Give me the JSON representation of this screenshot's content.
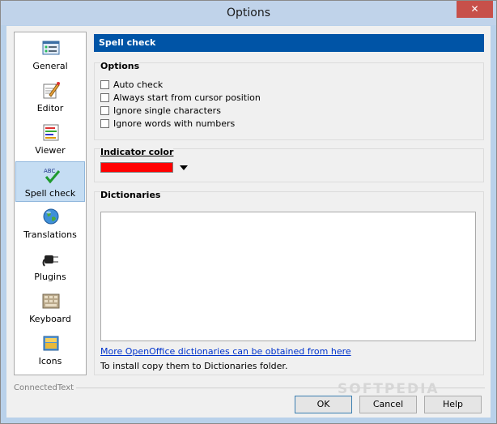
{
  "window": {
    "title": "Options",
    "close_glyph": "✕"
  },
  "sidebar": {
    "items": [
      {
        "label": "General",
        "icon": "general-icon"
      },
      {
        "label": "Editor",
        "icon": "editor-icon"
      },
      {
        "label": "Viewer",
        "icon": "viewer-icon"
      },
      {
        "label": "Spell check",
        "icon": "spell-check-icon",
        "selected": true,
        "icon_text": "ABC"
      },
      {
        "label": "Translations",
        "icon": "globe-icon"
      },
      {
        "label": "Plugins",
        "icon": "plug-icon"
      },
      {
        "label": "Keyboard",
        "icon": "keyboard-icon"
      },
      {
        "label": "Icons",
        "icon": "folder-icon"
      }
    ]
  },
  "panel": {
    "header": "Spell check",
    "options": {
      "title": "Options",
      "checkboxes": [
        {
          "label": "Auto check",
          "checked": false
        },
        {
          "label": "Always start from cursor position",
          "checked": false
        },
        {
          "label": "Ignore single characters",
          "checked": false
        },
        {
          "label": "Ignore words with numbers",
          "checked": false
        }
      ]
    },
    "indicator": {
      "title": "Indicator color",
      "color": "#ff0000"
    },
    "dictionaries": {
      "title": "Dictionaries",
      "link": "More OpenOffice dictionaries can be obtained from here",
      "note": "To install copy them to Dictionaries folder."
    }
  },
  "footer": {
    "brand": "ConnectedText",
    "ok": "OK",
    "cancel": "Cancel",
    "help": "Help",
    "watermark": "SOFTPEDIA"
  },
  "colors": {
    "header_bg": "#0054a6",
    "selected_bg": "#c5ddf3",
    "titlebar": "#c0d3ea",
    "close": "#c7504a"
  }
}
